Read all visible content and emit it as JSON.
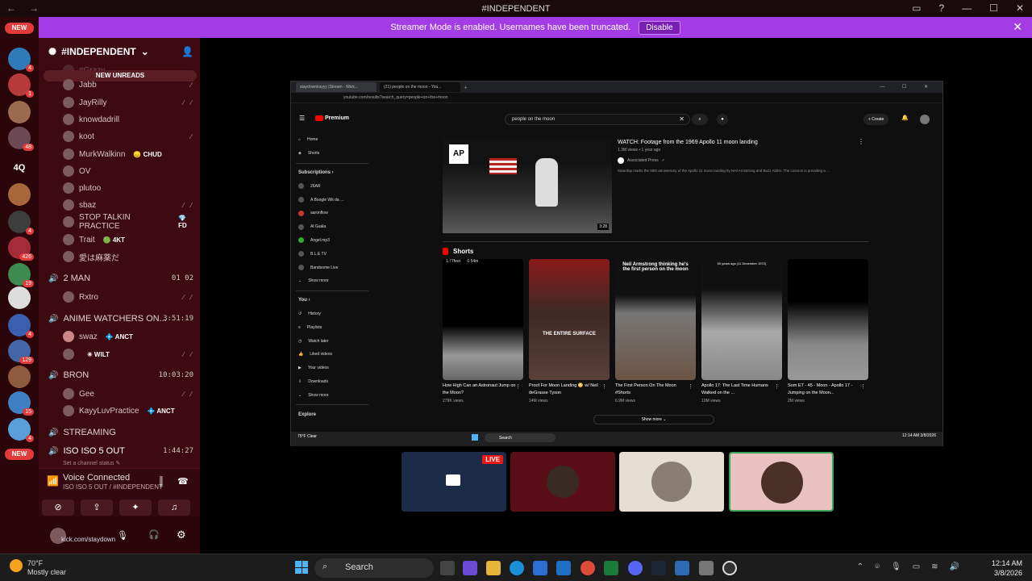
{
  "window": {
    "title": "#INDEPENDENT"
  },
  "banner": {
    "text": "Streamer Mode is enabled. Usernames have been truncated.",
    "button": "Disable"
  },
  "servers": {
    "new_top": "NEW",
    "new_bottom": "NEW",
    "text_icon": "4Q",
    "badges": [
      "4",
      "4",
      "1",
      "48",
      "4",
      "426",
      "19",
      "4",
      "129",
      "15",
      "4"
    ]
  },
  "sidebar": {
    "server_name": "#INDEPENDENT",
    "new_unreads": "NEW UNREADS",
    "partial_user": "#Grazy",
    "users": [
      {
        "name": "Jabb",
        "tag": ""
      },
      {
        "name": "JayRilly",
        "tag": ""
      },
      {
        "name": "knowdadrill",
        "tag": ""
      },
      {
        "name": "koot",
        "tag": ""
      },
      {
        "name": "MurkWalkinn",
        "tag": "😞 CHUD"
      },
      {
        "name": "OV",
        "tag": ""
      },
      {
        "name": "plutoo",
        "tag": ""
      },
      {
        "name": "sbaz",
        "tag": ""
      },
      {
        "name": "STOP TALKIN PRACTICE",
        "tag": "💎 FD"
      },
      {
        "name": "Trait",
        "tag": "🟢 4KT"
      },
      {
        "name": "愛は麻薬だ",
        "tag": ""
      }
    ],
    "channels": [
      {
        "name": "2 MAN",
        "time": "01  02"
      },
      {
        "name": "ANIME WATCHERS ON...",
        "time": "3:51:19"
      },
      {
        "name": "BRON",
        "time": "10:03:20"
      },
      {
        "name": "STREAMING",
        "time": ""
      },
      {
        "name": "ISO ISO 5 OUT",
        "time": "1:44:27"
      }
    ],
    "users2": [
      {
        "name": "Rxtro",
        "tag": ""
      },
      {
        "name": "swaz",
        "tag": "💠 ANCT"
      },
      {
        "name": "",
        "tag": "✳ WILT"
      },
      {
        "name": "Gee",
        "tag": ""
      },
      {
        "name": "KayyLuvPractice",
        "tag": "💠 ANCT"
      }
    ],
    "channel_status": "Set a channel status ✎"
  },
  "voice": {
    "status": "Voice Connected",
    "channel": "ISO ISO 5 OUT / #INDEPENDENT"
  },
  "userbar": {
    "name": "kick.com/staydown"
  },
  "browser": {
    "tab1": "staydownkayyy |Stream - Watc...",
    "tab2": "(21) people on the moon - You...",
    "url": "youtube.com/results?search_query=people+on+the+moon",
    "search_value": "people on the moon",
    "logo": "Premium",
    "create": "+ Create",
    "notif_count": "9+",
    "nav": [
      "Home",
      "Shorts"
    ],
    "subs_header": "Subscriptions ›",
    "subs": [
      "26AR",
      "A Boogie Wit da ...",
      "aaronflow",
      "Al Guala",
      "Angel.mp3",
      "B.L.E TV",
      "Bandsome Live",
      "Show more"
    ],
    "you_header": "You ›",
    "you": [
      "History",
      "Playlists",
      "Watch later",
      "Liked videos",
      "Your videos",
      "Downloads",
      "Show more"
    ],
    "explore": "Explore",
    "video": {
      "title": "WATCH: Footage from the 1969 Apollo 11 moon landing",
      "meta": "1.3M views • 1 year ago",
      "channel": "Associated Press",
      "desc": "Saturday marks the 55th anniversary of the Apollo 11 moon landing by Neil Armstrong and Buzz Aldrin. The cosmos is providing a ...",
      "duration": "3:28",
      "logo": "AP"
    },
    "shorts_header": "Shorts",
    "shorts": [
      {
        "title": "How High Can an Astronaut Jump on the Moon?",
        "views": "279K views",
        "overlay": "1.77feet      0.54m"
      },
      {
        "title": "Proof For Moon Landing 😳 w/ Neil deGrasse Tyson",
        "views": "14M views",
        "overlay": "THE ENTIRE SURFACE"
      },
      {
        "title": "The First Person On The Moon #Shorts",
        "views": "6.9M views",
        "overlay": "Neil Armstrong thinking he's the first person on the moon"
      },
      {
        "title": "Apollo 17: The Last Time Humans Walked on the ...",
        "views": "10M views",
        "overlay": "50 years ago (11 December 1972)"
      },
      {
        "title": "Som ET - 45 - Moon - Apollo 17 - Jumping on the Moon...",
        "views": "2M views",
        "overlay": ""
      }
    ],
    "show_more": "Show more ⌄",
    "inner_weather": "75°F Clear",
    "inner_search": "Search",
    "inner_clock": "12:14 AM 3/8/2026"
  },
  "stream_tiles": {
    "live": "LIVE"
  },
  "taskbar": {
    "temp": "70°F",
    "cond": "Mostly clear",
    "search": "Search",
    "time": "12:14 AM",
    "date": "3/8/2026"
  }
}
